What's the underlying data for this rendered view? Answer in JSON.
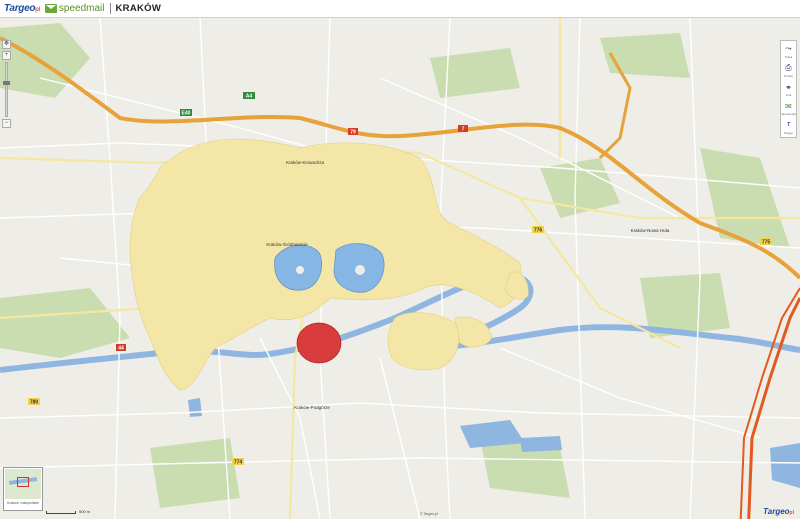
{
  "header": {
    "brand": "Targeo",
    "brand_suffix": "pl",
    "partner": "speedmail",
    "city": "KRAKÓW"
  },
  "map": {
    "city_name": "Kraków",
    "districts": [
      {
        "key": "krowodrza",
        "label": "Kraków-Krowodrza"
      },
      {
        "key": "srodmiescie",
        "label": "Kraków-Śródmieście"
      },
      {
        "key": "nowahuta",
        "label": "Kraków-Nowa Huta"
      },
      {
        "key": "podgorze",
        "label": "Kraków-Podgórze"
      }
    ],
    "road_badges": [
      {
        "key": "a4w",
        "text": "A4"
      },
      {
        "key": "e40",
        "text": "E40"
      },
      {
        "key": "r79",
        "text": "79"
      },
      {
        "key": "r7",
        "text": "7"
      },
      {
        "key": "r776",
        "text": "776"
      },
      {
        "key": "r44",
        "text": "44"
      },
      {
        "key": "r780",
        "text": "780"
      },
      {
        "key": "r774",
        "text": "774"
      },
      {
        "key": "r775",
        "text": "775"
      }
    ],
    "overlay_zones": [
      {
        "name": "yellow",
        "color": "#f3e6a7"
      },
      {
        "name": "blue",
        "color": "#86b6e4"
      },
      {
        "name": "red",
        "color": "#d83c3c"
      }
    ],
    "colors": {
      "land": "#eeede7",
      "water": "#8fb6e0",
      "greenery": "#c9ddb0",
      "motorway": "#e8a23a",
      "highway_orange": "#e35a1e"
    }
  },
  "minimap": {
    "caption": "Kraków, małopolskie"
  },
  "scale": {
    "label": "500 m"
  },
  "footer": {
    "brand": "Targeo",
    "brand_suffix": "pl",
    "copyright": "© Targeo.pl"
  },
  "tools": [
    {
      "key": "route",
      "label": "Trasa",
      "icon": "route-icon"
    },
    {
      "key": "print",
      "label": "Drukuj",
      "icon": "print-icon"
    },
    {
      "key": "link",
      "label": "Link",
      "icon": "link-icon"
    },
    {
      "key": "speedmail",
      "label": "Speedmail",
      "icon": "mail-icon"
    },
    {
      "key": "logo",
      "label": "Targeo",
      "icon": "targeo-icon"
    }
  ]
}
